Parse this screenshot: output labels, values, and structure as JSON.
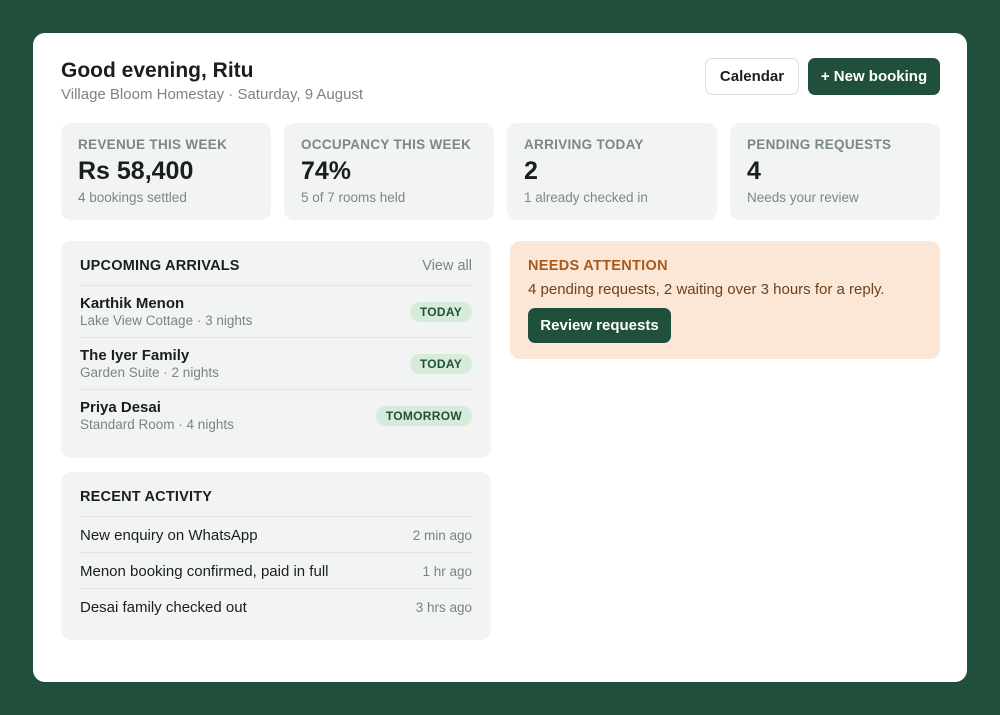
{
  "header": {
    "greeting": "Good evening, Ritu",
    "subtitle": "Village Bloom Homestay · Saturday, 9 August",
    "calendar_label": "Calendar",
    "new_booking_label": "+ New booking"
  },
  "stats": [
    {
      "label": "REVENUE THIS WEEK",
      "value": "Rs 58,400",
      "note": "4 bookings settled"
    },
    {
      "label": "OCCUPANCY THIS WEEK",
      "value": "74%",
      "note": "5 of 7 rooms held"
    },
    {
      "label": "ARRIVING TODAY",
      "value": "2",
      "note": "1 already checked in"
    },
    {
      "label": "PENDING REQUESTS",
      "value": "4",
      "note": "Needs your review"
    }
  ],
  "arrivals": {
    "title": "UPCOMING ARRIVALS",
    "view_all": "View all",
    "items": [
      {
        "name": "Karthik Menon",
        "detail": "Lake View Cottage · 3 nights",
        "badge": "TODAY"
      },
      {
        "name": "The Iyer Family",
        "detail": "Garden Suite · 2 nights",
        "badge": "TODAY"
      },
      {
        "name": "Priya Desai",
        "detail": "Standard Room · 4 nights",
        "badge": "TOMORROW"
      }
    ]
  },
  "activity": {
    "title": "RECENT ACTIVITY",
    "items": [
      {
        "text": "New enquiry on WhatsApp",
        "time": "2 min ago"
      },
      {
        "text": "Menon booking confirmed, paid in full",
        "time": "1 hr ago"
      },
      {
        "text": "Desai family checked out",
        "time": "3 hrs ago"
      }
    ]
  },
  "attention": {
    "title": "NEEDS ATTENTION",
    "text": "4 pending requests, 2 waiting over 3 hours for a reply.",
    "button": "Review requests"
  },
  "colors": {
    "brand": "#20503c",
    "attention_bg": "#fce7d7",
    "attention_title": "#a65a1c",
    "badge_bg": "#d6ebd9"
  }
}
